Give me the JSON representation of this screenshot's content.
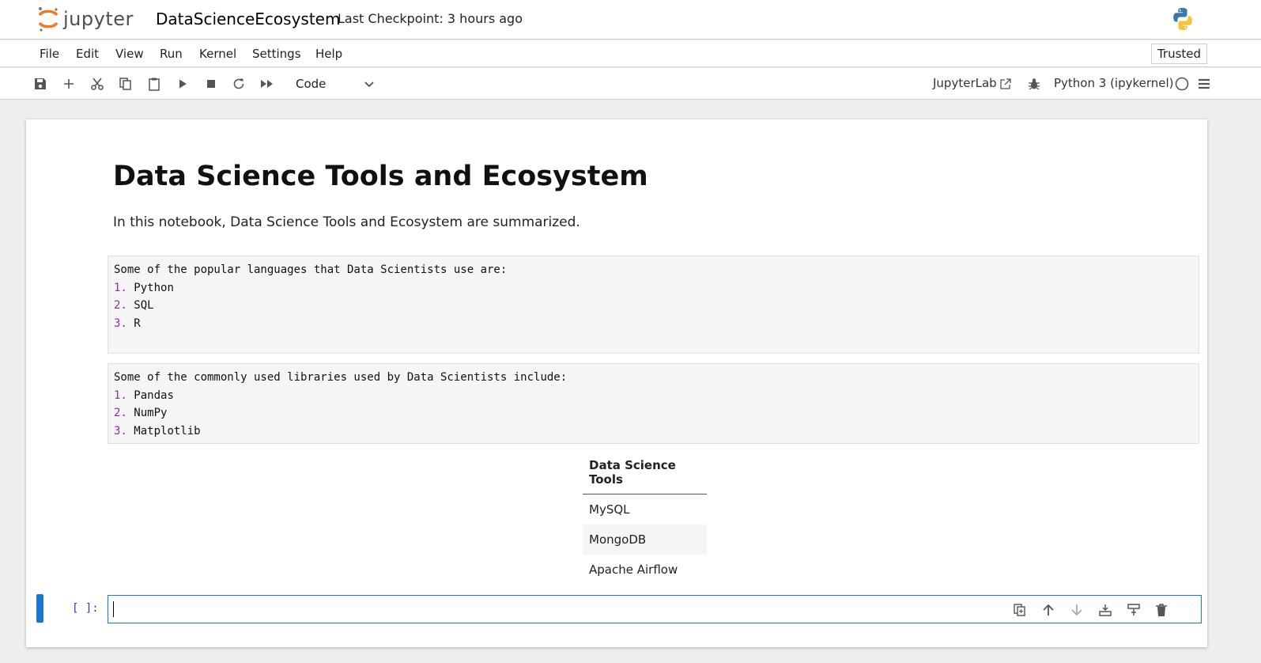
{
  "header": {
    "logo_text": "jupyter",
    "notebook_title": "DataScienceEcosystem",
    "checkpoint": "Last Checkpoint: 3 hours ago",
    "kernel_logo": "python-logo-icon"
  },
  "menu": {
    "items": [
      "File",
      "Edit",
      "View",
      "Run",
      "Kernel",
      "Settings",
      "Help"
    ],
    "trusted": "Trusted"
  },
  "toolbar": {
    "buttons": [
      "save-icon",
      "add-icon",
      "cut-icon",
      "copy-icon",
      "paste-icon",
      "run-icon",
      "stop-icon",
      "restart-icon",
      "fast-forward-icon"
    ],
    "cell_type": "Code",
    "jupyterlab": "JupyterLab",
    "kernel_name": "Python 3 (ipykernel)"
  },
  "notebook": {
    "title": "Data Science Tools and Ecosystem",
    "intro": "In this notebook, Data Science Tools and Ecosystem are summarized.",
    "languages_block": {
      "heading": "Some of the popular languages that Data Scientists use are:",
      "items": [
        {
          "num": "1.",
          "text": "Python"
        },
        {
          "num": "2.",
          "text": "SQL"
        },
        {
          "num": "3.",
          "text": "R"
        }
      ]
    },
    "libraries_block": {
      "heading": "Some of the commonly used libraries used by Data Scientists include:",
      "items": [
        {
          "num": "1.",
          "text": "Pandas"
        },
        {
          "num": "2.",
          "text": "NumPy"
        },
        {
          "num": "3.",
          "text": "Matplotlib"
        }
      ]
    },
    "table": {
      "header": "Data Science Tools",
      "rows": [
        "MySQL",
        "MongoDB",
        "Apache Airflow"
      ]
    },
    "code_cell": {
      "prompt": "[ ]:",
      "value": ""
    }
  },
  "colors": {
    "accent": "#1976d2",
    "list_number": "#9c27b0",
    "prompt": "#303f9f",
    "logo_orange": "#f37726"
  }
}
